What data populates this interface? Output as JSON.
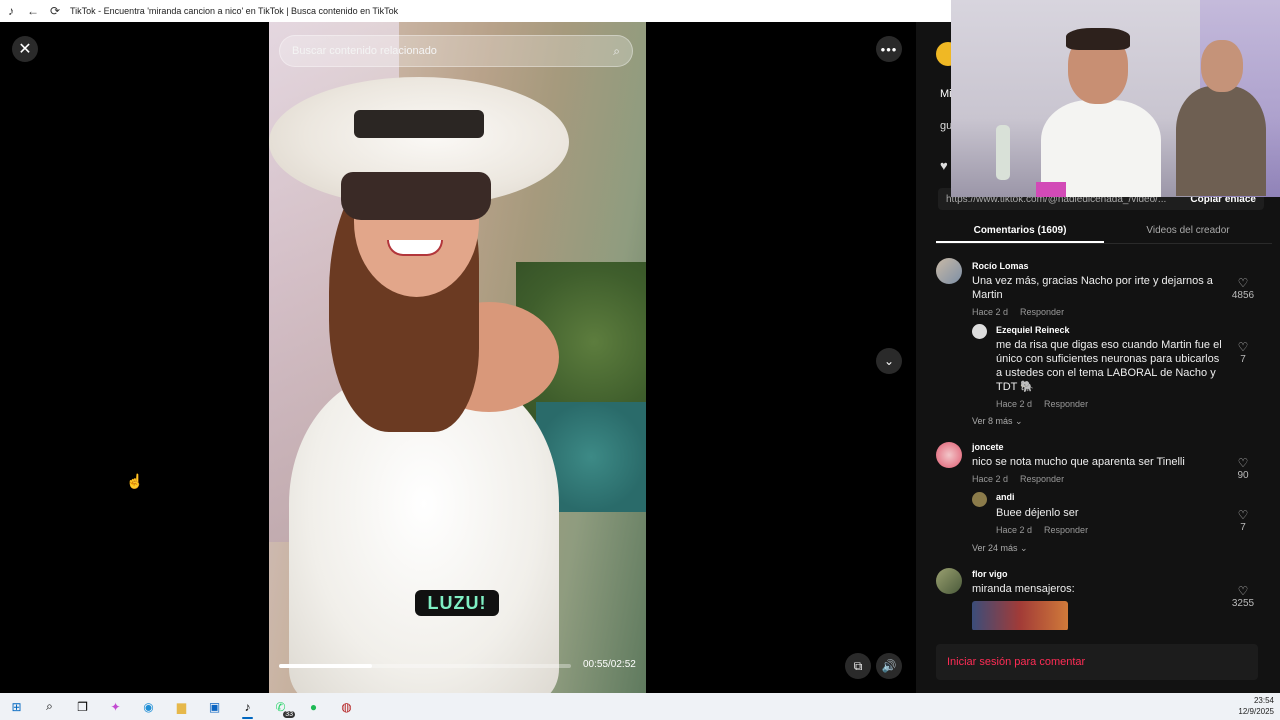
{
  "browser": {
    "title": "TikTok - Encuentra 'miranda cancion a nico' en TikTok | Busca contenido en TikTok"
  },
  "video": {
    "search_placeholder": "Buscar contenido relacionado",
    "watermark": "LUZU!",
    "time": "00:55/02:52",
    "progress": 0.32
  },
  "panel": {
    "desc_line1": "Mi",
    "desc_line2": "gu",
    "link_url": "https://www.tiktok.com/@nadiedicenada_/video/...",
    "copy_label": "Copiar enlace",
    "tabs": [
      {
        "label": "Comentarios (1609)",
        "active": true
      },
      {
        "label": "Videos del creador",
        "active": false
      }
    ],
    "comments": [
      {
        "user": "Rocío Lomas",
        "text": "Una vez más, gracias Nacho por irte y dejarnos a Martin",
        "time": "Hace 2 d",
        "reply": "Responder",
        "likes": "4856"
      },
      {
        "user": "Ezequiel Reineck",
        "text": "me da risa que digas eso cuando Martin fue el único con suficientes neuronas para ubicarlos a ustedes con el tema LABORAL de Nacho y TDT 🐘",
        "time": "Hace 2 d",
        "reply": "Responder",
        "likes": "7"
      },
      {
        "more": "Ver 8 más"
      },
      {
        "user": "joncete",
        "text": "nico se nota mucho que aparenta ser Tinelli",
        "time": "Hace 2 d",
        "reply": "Responder",
        "likes": "90"
      },
      {
        "user": "andi",
        "text": "Buee déjenlo ser",
        "time": "Hace 2 d",
        "reply": "Responder",
        "likes": "7"
      },
      {
        "more": "Ver 24 más"
      },
      {
        "user": "flor vigo",
        "text": "miranda mensajeros:",
        "likes": "3255"
      }
    ],
    "login_label": "Iniciar sesión para comentar"
  },
  "taskbar": {
    "whatsapp_badge": "33",
    "time": "23:54",
    "date": "12/9/2025"
  },
  "colors": {
    "tiktok_red": "#fe2c55",
    "panel_bg": "#121212",
    "taskbar_bg": "#eff2f6"
  }
}
